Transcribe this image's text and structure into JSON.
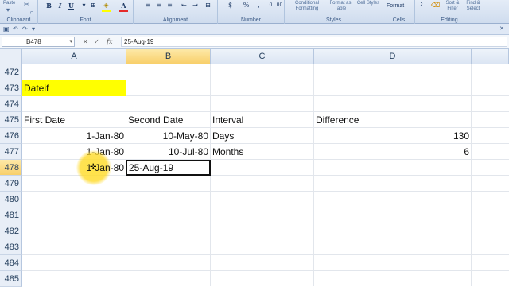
{
  "ribbon": {
    "clipboard": {
      "paste_label": "Paste",
      "group_label": "Clipboard"
    },
    "font": {
      "bold": "B",
      "italic": "I",
      "underline": "U",
      "font_color": "A",
      "group_label": "Font"
    },
    "alignment": {
      "group_label": "Alignment"
    },
    "number": {
      "currency": "$",
      "percent": "%",
      "comma": ",",
      "group_label": "Number"
    },
    "styles": {
      "conditional_formatting": "Conditional Formatting",
      "format_as_table": "Format as Table",
      "cell_styles": "Cell Styles",
      "group_label": "Styles"
    },
    "cells": {
      "format_label": "Format",
      "group_label": "Cells"
    },
    "editing": {
      "sort_filter": "Sort & Filter",
      "find_select": "Find & Select",
      "group_label": "Editing"
    },
    "colors": {
      "font_red": "#e52b2b",
      "fill_yellow": "#ffff00"
    }
  },
  "formula_bar": {
    "name_box": "B478",
    "formula": "25-Aug-19"
  },
  "grid": {
    "columns": [
      "A",
      "B",
      "C",
      "D"
    ],
    "active_column": "B",
    "active_row": "478",
    "rows": [
      {
        "num": "472"
      },
      {
        "num": "473",
        "a": "Dateif"
      },
      {
        "num": "474"
      },
      {
        "num": "475",
        "a": "First Date",
        "b": "Second Date",
        "c": "Interval",
        "d": "Difference"
      },
      {
        "num": "476",
        "a": "1-Jan-80",
        "b": "10-May-80",
        "c": "Days",
        "d": "130"
      },
      {
        "num": "477",
        "a": "1-Jan-80",
        "b": "10-Jul-80",
        "c": "Months",
        "d": "6"
      },
      {
        "num": "478",
        "a": "1-Jan-80",
        "b": "25-Aug-19"
      },
      {
        "num": "479"
      },
      {
        "num": "480"
      },
      {
        "num": "481"
      },
      {
        "num": "482"
      },
      {
        "num": "483"
      },
      {
        "num": "484"
      },
      {
        "num": "485"
      }
    ],
    "highlight_color": "#ffff00"
  }
}
